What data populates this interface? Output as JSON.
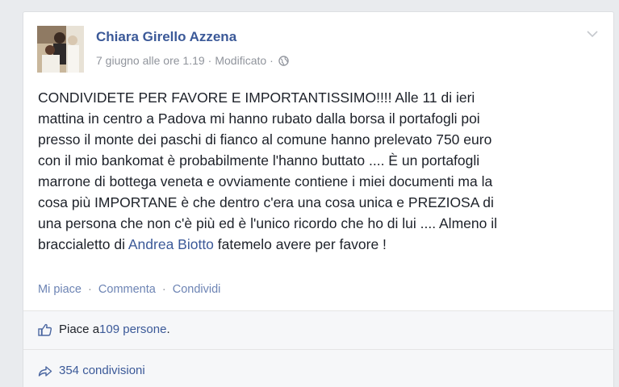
{
  "post": {
    "author": "Chiara Girello Azzena",
    "timestamp": "7 giugno alle ore 1.19",
    "separator": "·",
    "edited": "Modificato",
    "privacy_icon": "globe-icon",
    "menu_icon": "chevron-down-icon",
    "text_before_tag": "CONDIVIDETE PER FAVORE E IMPORTANTISSIMO!!!! Alle 11 di ieri\nmattina in centro a Padova mi hanno rubato dalla borsa il portafogli poi\npresso il monte dei paschi di fianco al comune hanno prelevato 750 euro\ncon il mio bankomat è probabilmente l'hanno buttato .... È un portafogli\nmarrone di bottega veneta e ovviamente contiene i miei documenti ma la\ncosa più IMPORTANE è che dentro c'era una cosa unica e PREZIOSA di\nuna persona che non c'è più ed è l'unico ricordo che ho di lui .... Almeno il\nbraccialetto di ",
    "tagged_person": "Andrea Biotto",
    "text_after_tag": " fatemelo avere per favore !"
  },
  "actions": {
    "like": "Mi piace",
    "comment": "Commenta",
    "share": "Condividi",
    "dot": "·"
  },
  "stats": {
    "likes_prefix": "Piace a ",
    "likes_link": "109 persone",
    "likes_suffix": ".",
    "likes_icon": "thumbs-up-icon",
    "shares_link": "354 condivisioni",
    "shares_icon": "share-arrow-icon"
  },
  "colors": {
    "link": "#3b5998",
    "muted": "#90949c",
    "background": "#e9ebee"
  }
}
